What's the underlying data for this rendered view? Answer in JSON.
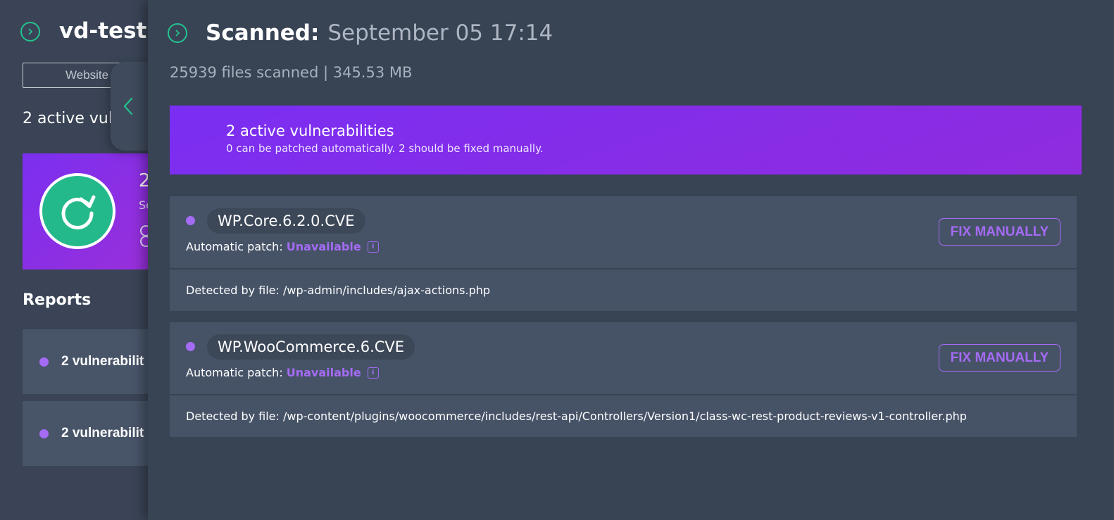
{
  "background": {
    "site_title": "vd-test.r",
    "website_button": "Website",
    "active_vulns": "2 active vul",
    "card": {
      "number": "2",
      "sub": "Sc",
      "icon": "share-icon"
    },
    "reports_heading": "Reports",
    "reports": [
      {
        "label": "2 vulnerabilit"
      },
      {
        "label": "2 vulnerabilit"
      }
    ]
  },
  "drawer": {
    "scanned_label": "Scanned:",
    "scanned_date": "September 05 17:14",
    "stats": "25939 files scanned | 345.53 MB",
    "banner": {
      "title": "2 active vulnerabilities",
      "subtitle": "0 can be patched automatically. 2 should be fixed manually."
    },
    "vulnerabilities": [
      {
        "name": "WP.Core.6.2.0.CVE",
        "patch_label": "Automatic patch:",
        "patch_value": "Unavailable",
        "action": "FIX MANUALLY",
        "detected": "Detected by file: /wp-admin/includes/ajax-actions.php"
      },
      {
        "name": "WP.WooCommerce.6.CVE",
        "patch_label": "Automatic patch:",
        "patch_value": "Unavailable",
        "action": "FIX MANUALLY",
        "detected": "Detected by file: /wp-content/plugins/woocommerce/includes/rest-api/Controllers/Version1/class-wc-rest-product-reviews-v1-controller.php"
      }
    ]
  },
  "colors": {
    "accent_green": "#23c28f",
    "accent_purple": "#a56bf5",
    "banner_purple": "#7a2ef2",
    "panel_bg": "#384354"
  }
}
